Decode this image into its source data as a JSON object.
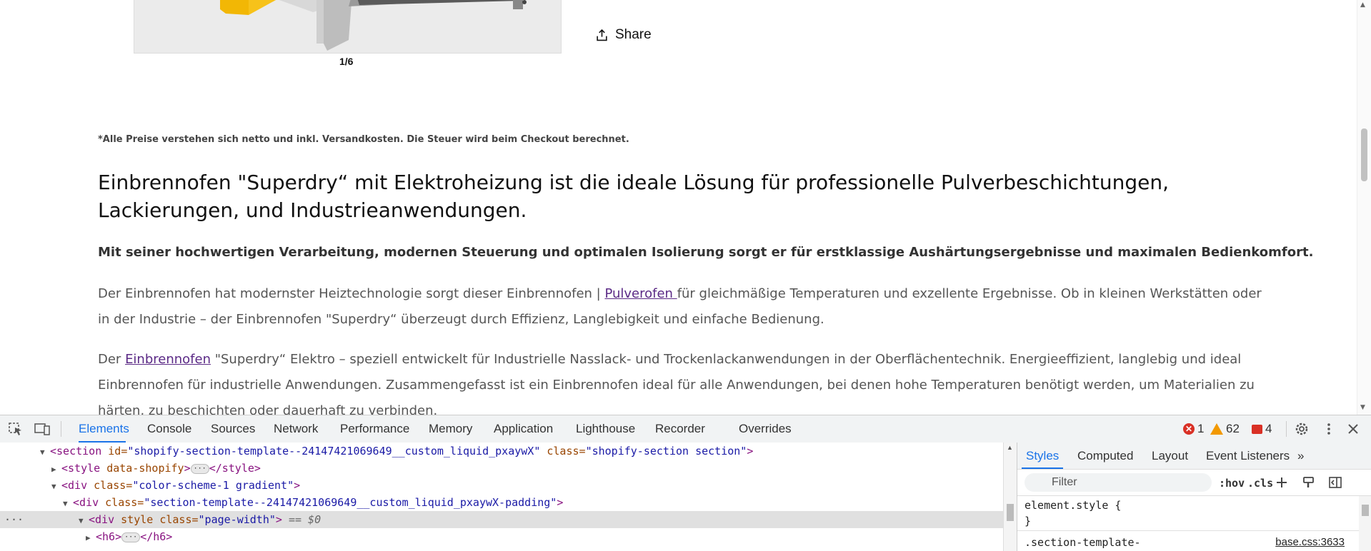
{
  "page": {
    "image_counter": "1/6",
    "share_label": "Share",
    "price_note": "*Alle Preise verstehen sich netto und inkl. Versandkosten. Die Steuer wird beim Checkout berechnet.",
    "heading": "Einbrennofen \"Superdry“ mit Elektroheizung ist die ideale Lösung für professionelle Pulverbeschichtungen, Lackierungen, und Industrieanwendungen.",
    "subheading": "Mit seiner hochwertigen Verarbeitung, modernen Steuerung und optimalen Isolierung sorgt er für erstklassige Aushärtungsergebnisse und maximalen Bedienkomfort.",
    "para1": {
      "before": "Der Einbrennofen hat modernster Heiztechnologie sorgt dieser Einbrennofen | ",
      "link": "Pulverofen ",
      "after": " für gleichmäßige Temperaturen und exzellente Ergebnisse. Ob in kleinen Werkstätten oder in der Industrie – der Einbrennofen  \"Superdry“ überzeugt durch Effizienz, Langlebigkeit und einfache Bedienung."
    },
    "para2": {
      "before": "Der ",
      "link": "Einbrennofen",
      "after": " \"Superdry“ Elektro – speziell entwickelt für Industrielle Nasslack- und Trockenlackanwendungen in der Oberflächentechnik. Energieeffizient, langlebig und ideal Einbrennofen für industrielle Anwendungen. Zusammengefasst ist ein Einbrennofen ideal für alle Anwendungen, bei denen hohe Temperaturen benötigt werden, um Materialien zu härten, zu beschichten oder dauerhaft zu verbinden."
    }
  },
  "devtools": {
    "tabs": [
      "Elements",
      "Console",
      "Sources",
      "Network",
      "Performance",
      "Memory",
      "Application",
      "Lighthouse",
      "Recorder",
      "Overrides"
    ],
    "active_tab": "Elements",
    "errors": "1",
    "warnings": "62",
    "issues": "4",
    "dom": {
      "l1": {
        "tag_open": "<section",
        "id_attr": " id=",
        "id_val": "\"shopify-section-template--24147421069649__custom_liquid_pxaywX\"",
        "class_attr": " class=",
        "class_val": "\"shopify-section section\"",
        "close": ">"
      },
      "l2": {
        "tag_open": "<style",
        "attr": " data-shopify",
        "close": ">",
        "ellipsis": "···",
        "end": "</style>"
      },
      "l3": {
        "tag_open": "<div",
        "class_attr": " class=",
        "class_val": "\"color-scheme-1 gradient\"",
        "close": ">"
      },
      "l4": {
        "tag_open": "<div",
        "class_attr": " class=",
        "class_val": "\"section-template--24147421069649__custom_liquid_pxaywX-padding\"",
        "close": ">"
      },
      "l5": {
        "tag_open": "<div",
        "style_attr": " style",
        "class_attr": " class=",
        "class_val": "\"page-width\"",
        "close": ">",
        "eq": " == $0"
      },
      "l6": {
        "tag_open": "<h6>",
        "ellipsis": "···",
        "end": "</h6>"
      },
      "dots": "···"
    },
    "styles_tabs": [
      "Styles",
      "Computed",
      "Layout",
      "Event Listeners"
    ],
    "active_styles_tab": "Styles",
    "filter_placeholder": "Filter",
    "hov": ":hov",
    "cls": ".cls",
    "element_style_open": "element.style {",
    "element_style_close": "}",
    "rule_selector": ".section-template-",
    "rule_source": "base.css:3633"
  }
}
